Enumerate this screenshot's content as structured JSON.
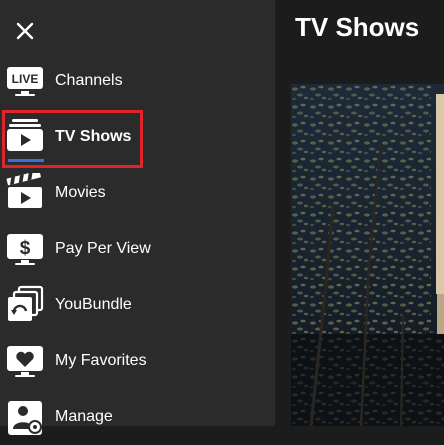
{
  "header": {
    "title": "TV Shows"
  },
  "sidebar": {
    "items": [
      {
        "label": "Channels",
        "icon": "live-tv-icon",
        "badge": "LIVE"
      },
      {
        "label": "TV Shows",
        "icon": "tv-shows-icon",
        "active": true
      },
      {
        "label": "Movies",
        "icon": "clapperboard-icon"
      },
      {
        "label": "Pay Per View",
        "icon": "dollar-tv-icon"
      },
      {
        "label": "YouBundle",
        "icon": "bundle-stack-icon"
      },
      {
        "label": "My Favorites",
        "icon": "heart-tv-icon"
      },
      {
        "label": "Manage",
        "icon": "manage-user-icon"
      }
    ]
  },
  "colors": {
    "sidebar_bg": "#2b2b2b",
    "page_bg": "#1c1c1c",
    "text": "#ffffff",
    "active_underline": "#3f6de0",
    "highlight_border": "#e0242b"
  }
}
